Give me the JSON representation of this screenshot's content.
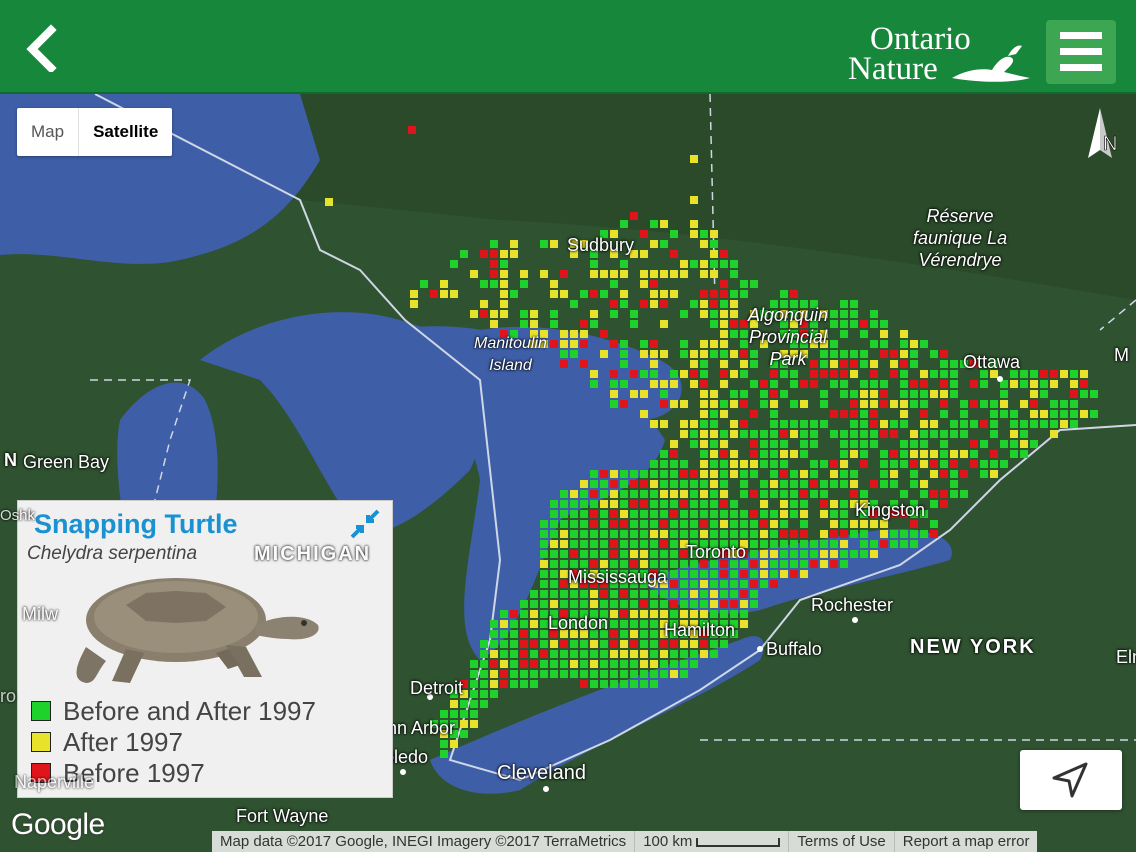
{
  "header": {
    "back_icon": "chevron-left-icon",
    "logo_line1": "Ontario",
    "logo_line2": "Nature",
    "menu_icon": "hamburger-menu-icon",
    "color": "#16873b"
  },
  "map_type": {
    "map_label": "Map",
    "satellite_label": "Satellite",
    "selected": "Satellite"
  },
  "labels": {
    "sudbury": "Sudbury",
    "manitoulin": "Manitoulin\nIsland",
    "algonquin": "Algonquin\nProvincial\nPark",
    "reserve": "Réserve\nfaunique La\nVérendrye",
    "ottawa": "Ottawa",
    "m_edge": "M",
    "green_bay": "Green Bay",
    "n_edge": "N",
    "oshk": "Oshk",
    "michigan": "MICHIGAN",
    "milw": "Milw",
    "kingston": "Kingston",
    "toronto": "Toronto",
    "mississauga": "Mississauga",
    "rochester": "Rochester",
    "london": "London",
    "hamilton": "Hamilton",
    "buffalo": "Buffalo",
    "new_york": "NEW YORK",
    "detroit": "Detroit",
    "ann_arbor": "Ann Arbor",
    "toledo": "Toledo",
    "cleveland": "Cleveland",
    "fort_wayne": "Fort Wayne",
    "naperville": "Naperville",
    "ro": "ro",
    "elmira": "Elmir"
  },
  "legend": {
    "common_name": "Snapping Turtle",
    "scientific_name": "Chelydra serpentina",
    "collapse_icon": "collapse-arrows-icon",
    "image_icon": "snapping-turtle-illustration",
    "items": [
      {
        "label": "Before and After 1997",
        "color": "#1fd12b"
      },
      {
        "label": "After 1997",
        "color": "#e8e22a"
      },
      {
        "label": "Before 1997",
        "color": "#e0141b"
      }
    ]
  },
  "compass": {
    "label": "N",
    "icon": "north-arrow-icon"
  },
  "location_button": {
    "icon": "navigation-arrow-icon"
  },
  "footer": {
    "google": "Google",
    "attribution": "Map data ©2017 Google, INEGI Imagery ©2017 TerraMetrics",
    "scale": "100 km",
    "terms": "Terms of Use",
    "report": "Report a map error"
  },
  "colors": {
    "land": "#2f5230",
    "water": "#3e5fa8",
    "both": "#1fd12b",
    "after": "#e8e22a",
    "before": "#e0141b",
    "legend_title": "#1a91d1"
  }
}
